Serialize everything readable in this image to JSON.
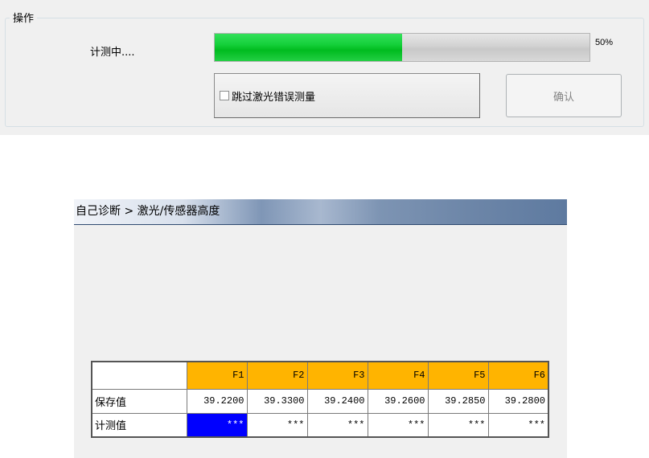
{
  "operation": {
    "group_title": "操作",
    "status_text": "计测中....",
    "progress_percent": 50,
    "progress_label": "50%",
    "skip_checkbox": {
      "label": "跳过激光错误测量",
      "checked": false
    },
    "confirm_label": "确认",
    "colors": {
      "progress_fill": "#14d03a",
      "confirm_text_disabled": "#838383"
    }
  },
  "diagnostic": {
    "breadcrumb": "自己诊断 > 激光/传感器高度",
    "table": {
      "columns": [
        "F1",
        "F2",
        "F3",
        "F4",
        "F5",
        "F6"
      ],
      "rows": [
        {
          "label": "保存值",
          "values": [
            "39.2200",
            "39.3300",
            "39.2400",
            "39.2600",
            "39.2850",
            "39.2800"
          ]
        },
        {
          "label": "计测值",
          "values": [
            "***",
            "***",
            "***",
            "***",
            "***",
            "***"
          ]
        }
      ],
      "colors": {
        "header_bg": "#ffb400",
        "selected_bg": "#0000ff"
      }
    }
  }
}
